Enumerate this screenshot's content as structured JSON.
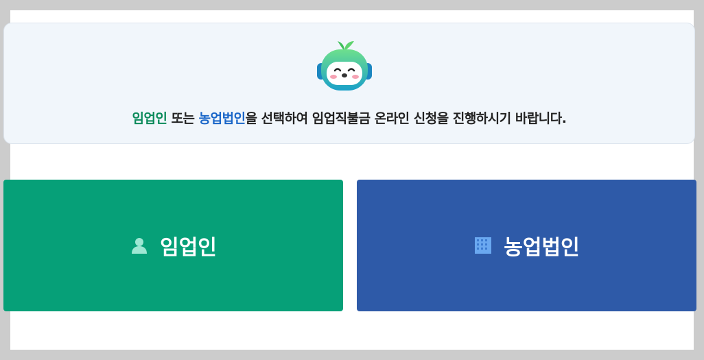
{
  "notice": {
    "part1": "임업인",
    "part2": " 또는 ",
    "part3": "농업법인",
    "part4": "을 선택하여 임업직불금 온라인 신청을 진행하시기 바랍니다."
  },
  "buttons": {
    "forest": {
      "label": "임업인",
      "icon": "person-icon",
      "color": "#06a078"
    },
    "corporation": {
      "label": "농업법인",
      "icon": "building-icon",
      "color": "#2e5aa8"
    }
  }
}
